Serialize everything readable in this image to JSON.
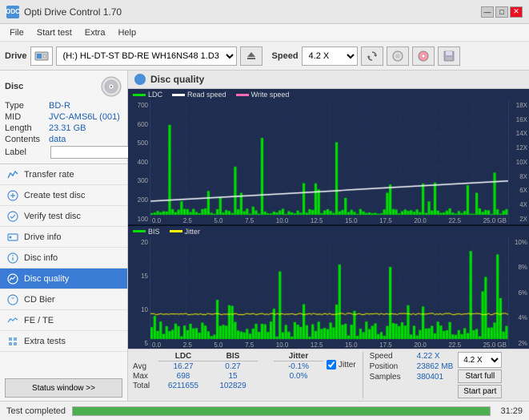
{
  "app": {
    "title": "Opti Drive Control 1.70",
    "icon": "ODC"
  },
  "titlebar": {
    "minimize_label": "—",
    "maximize_label": "□",
    "close_label": "✕"
  },
  "menu": {
    "items": [
      "File",
      "Start test",
      "Extra",
      "Help"
    ]
  },
  "toolbar": {
    "drive_label": "Drive",
    "drive_value": "(H:) HL-DT-ST BD-RE  WH16NS48 1.D3",
    "speed_label": "Speed",
    "speed_value": "4.2 X"
  },
  "sidebar": {
    "disc_title": "Disc",
    "disc_type_label": "Type",
    "disc_type_value": "BD-R",
    "disc_mid_label": "MID",
    "disc_mid_value": "JVC-AMS6L (001)",
    "disc_length_label": "Length",
    "disc_length_value": "23.31 GB",
    "disc_contents_label": "Contents",
    "disc_contents_value": "data",
    "disc_label_label": "Label",
    "disc_label_value": "",
    "nav_items": [
      {
        "id": "transfer-rate",
        "label": "Transfer rate",
        "active": false
      },
      {
        "id": "create-test-disc",
        "label": "Create test disc",
        "active": false
      },
      {
        "id": "verify-test-disc",
        "label": "Verify test disc",
        "active": false
      },
      {
        "id": "drive-info",
        "label": "Drive info",
        "active": false
      },
      {
        "id": "disc-info",
        "label": "Disc info",
        "active": false
      },
      {
        "id": "disc-quality",
        "label": "Disc quality",
        "active": true
      },
      {
        "id": "cd-bier",
        "label": "CD Bier",
        "active": false
      },
      {
        "id": "fe-te",
        "label": "FE / TE",
        "active": false
      },
      {
        "id": "extra-tests",
        "label": "Extra tests",
        "active": false
      }
    ],
    "status_window_btn": "Status window >>"
  },
  "disc_quality": {
    "title": "Disc quality",
    "legend_upper": [
      {
        "label": "LDC",
        "color": "#00cc00"
      },
      {
        "label": "Read speed",
        "color": "#ffffff"
      },
      {
        "label": "Write speed",
        "color": "#ff69b4"
      }
    ],
    "legend_lower": [
      {
        "label": "BIS",
        "color": "#00cc00"
      },
      {
        "label": "Jitter",
        "color": "#ffff00"
      }
    ],
    "upper_y_labels": [
      "700",
      "600",
      "500",
      "400",
      "300",
      "200",
      "100"
    ],
    "upper_y_right_labels": [
      "18X",
      "16X",
      "14X",
      "12X",
      "10X",
      "8X",
      "6X",
      "4X",
      "2X"
    ],
    "lower_y_labels": [
      "20",
      "15",
      "10",
      "5"
    ],
    "lower_y_right_labels": [
      "10%",
      "8%",
      "6%",
      "4%",
      "2%"
    ],
    "x_labels": [
      "0.0",
      "2.5",
      "5.0",
      "7.5",
      "10.0",
      "12.5",
      "15.0",
      "17.5",
      "20.0",
      "22.5",
      "25.0 GB"
    ]
  },
  "stats": {
    "ldc_header": "LDC",
    "bis_header": "BIS",
    "jitter_header": "Jitter",
    "avg_label": "Avg",
    "max_label": "Max",
    "total_label": "Total",
    "avg_ldc": "16.27",
    "avg_bis": "0.27",
    "avg_jitter": "-0.1%",
    "max_ldc": "698",
    "max_bis": "15",
    "max_jitter": "0.0%",
    "total_ldc": "6211655",
    "total_bis": "102829",
    "jitter_checked": true,
    "jitter_label": "Jitter",
    "speed_label": "Speed",
    "speed_value": "4.22 X",
    "position_label": "Position",
    "position_value": "23862 MB",
    "samples_label": "Samples",
    "samples_value": "380401",
    "speed_select_value": "4.2 X",
    "start_full_label": "Start full",
    "start_part_label": "Start part"
  },
  "statusbar": {
    "text": "Test completed",
    "progress": 100,
    "time": "31:29"
  }
}
